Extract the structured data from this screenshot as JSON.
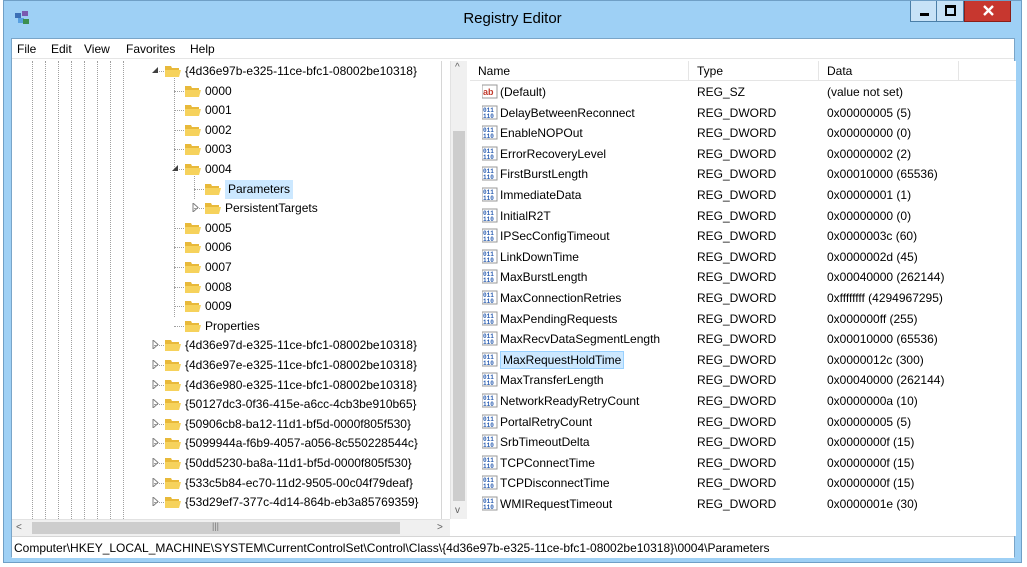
{
  "window": {
    "title": "Registry Editor"
  },
  "menu": [
    "File",
    "Edit",
    "View",
    "Favorites",
    "Help"
  ],
  "tree": [
    {
      "label": "{4d36e97b-e325-11ce-bfc1-08002be10318}",
      "level": 0,
      "expander": "open"
    },
    {
      "label": "0000",
      "level": 1,
      "expander": "none"
    },
    {
      "label": "0001",
      "level": 1,
      "expander": "none"
    },
    {
      "label": "0002",
      "level": 1,
      "expander": "none"
    },
    {
      "label": "0003",
      "level": 1,
      "expander": "none"
    },
    {
      "label": "0004",
      "level": 1,
      "expander": "open"
    },
    {
      "label": "Parameters",
      "level": 2,
      "expander": "none",
      "selected": true
    },
    {
      "label": "PersistentTargets",
      "level": 2,
      "expander": "closed"
    },
    {
      "label": "0005",
      "level": 1,
      "expander": "none"
    },
    {
      "label": "0006",
      "level": 1,
      "expander": "none"
    },
    {
      "label": "0007",
      "level": 1,
      "expander": "none"
    },
    {
      "label": "0008",
      "level": 1,
      "expander": "none"
    },
    {
      "label": "0009",
      "level": 1,
      "expander": "none"
    },
    {
      "label": "Properties",
      "level": 1,
      "expander": "none"
    },
    {
      "label": "{4d36e97d-e325-11ce-bfc1-08002be10318}",
      "level": 0,
      "expander": "closed"
    },
    {
      "label": "{4d36e97e-e325-11ce-bfc1-08002be10318}",
      "level": 0,
      "expander": "closed"
    },
    {
      "label": "{4d36e980-e325-11ce-bfc1-08002be10318}",
      "level": 0,
      "expander": "closed"
    },
    {
      "label": "{50127dc3-0f36-415e-a6cc-4cb3be910b65}",
      "level": 0,
      "expander": "closed"
    },
    {
      "label": "{50906cb8-ba12-11d1-bf5d-0000f805f530}",
      "level": 0,
      "expander": "closed"
    },
    {
      "label": "{5099944a-f6b9-4057-a056-8c550228544c}",
      "level": 0,
      "expander": "closed"
    },
    {
      "label": "{50dd5230-ba8a-11d1-bf5d-0000f805f530}",
      "level": 0,
      "expander": "closed"
    },
    {
      "label": "{533c5b84-ec70-11d2-9505-00c04f79deaf}",
      "level": 0,
      "expander": "closed"
    },
    {
      "label": "{53d29ef7-377c-4d14-864b-eb3a85769359}",
      "level": 0,
      "expander": "closed"
    }
  ],
  "list": {
    "columns": [
      "Name",
      "Type",
      "Data"
    ],
    "rows": [
      {
        "icon": "ab",
        "name": "(Default)",
        "type": "REG_SZ",
        "data": "(value not set)"
      },
      {
        "icon": "bin",
        "name": "DelayBetweenReconnect",
        "type": "REG_DWORD",
        "data": "0x00000005 (5)"
      },
      {
        "icon": "bin",
        "name": "EnableNOPOut",
        "type": "REG_DWORD",
        "data": "0x00000000 (0)"
      },
      {
        "icon": "bin",
        "name": "ErrorRecoveryLevel",
        "type": "REG_DWORD",
        "data": "0x00000002 (2)"
      },
      {
        "icon": "bin",
        "name": "FirstBurstLength",
        "type": "REG_DWORD",
        "data": "0x00010000 (65536)"
      },
      {
        "icon": "bin",
        "name": "ImmediateData",
        "type": "REG_DWORD",
        "data": "0x00000001 (1)"
      },
      {
        "icon": "bin",
        "name": "InitialR2T",
        "type": "REG_DWORD",
        "data": "0x00000000 (0)"
      },
      {
        "icon": "bin",
        "name": "IPSecConfigTimeout",
        "type": "REG_DWORD",
        "data": "0x0000003c (60)"
      },
      {
        "icon": "bin",
        "name": "LinkDownTime",
        "type": "REG_DWORD",
        "data": "0x0000002d (45)"
      },
      {
        "icon": "bin",
        "name": "MaxBurstLength",
        "type": "REG_DWORD",
        "data": "0x00040000 (262144)"
      },
      {
        "icon": "bin",
        "name": "MaxConnectionRetries",
        "type": "REG_DWORD",
        "data": "0xffffffff (4294967295)"
      },
      {
        "icon": "bin",
        "name": "MaxPendingRequests",
        "type": "REG_DWORD",
        "data": "0x000000ff (255)"
      },
      {
        "icon": "bin",
        "name": "MaxRecvDataSegmentLength",
        "type": "REG_DWORD",
        "data": "0x00010000 (65536)"
      },
      {
        "icon": "bin",
        "name": "MaxRequestHoldTime",
        "type": "REG_DWORD",
        "data": "0x0000012c (300)",
        "selected": true
      },
      {
        "icon": "bin",
        "name": "MaxTransferLength",
        "type": "REG_DWORD",
        "data": "0x00040000 (262144)"
      },
      {
        "icon": "bin",
        "name": "NetworkReadyRetryCount",
        "type": "REG_DWORD",
        "data": "0x0000000a (10)"
      },
      {
        "icon": "bin",
        "name": "PortalRetryCount",
        "type": "REG_DWORD",
        "data": "0x00000005 (5)"
      },
      {
        "icon": "bin",
        "name": "SrbTimeoutDelta",
        "type": "REG_DWORD",
        "data": "0x0000000f (15)"
      },
      {
        "icon": "bin",
        "name": "TCPConnectTime",
        "type": "REG_DWORD",
        "data": "0x0000000f (15)"
      },
      {
        "icon": "bin",
        "name": "TCPDisconnectTime",
        "type": "REG_DWORD",
        "data": "0x0000000f (15)"
      },
      {
        "icon": "bin",
        "name": "WMIRequestTimeout",
        "type": "REG_DWORD",
        "data": "0x0000001e (30)"
      }
    ]
  },
  "status": {
    "path": "Computer\\HKEY_LOCAL_MACHINE\\SYSTEM\\CurrentControlSet\\Control\\Class\\{4d36e97b-e325-11ce-bfc1-08002be10318}\\0004\\Parameters"
  },
  "icons": {
    "app": "registry-editor-icon",
    "minimize": "minimize-icon",
    "maximize": "maximize-icon",
    "close": "close-icon",
    "folder": "folder-icon",
    "string_value": "string-value-icon",
    "binary_value": "binary-value-icon"
  },
  "colors": {
    "window_frame": "#9ed0f5",
    "close_button": "#c7372f",
    "selection": "#cce8ff",
    "folder": "#e8b93a"
  }
}
